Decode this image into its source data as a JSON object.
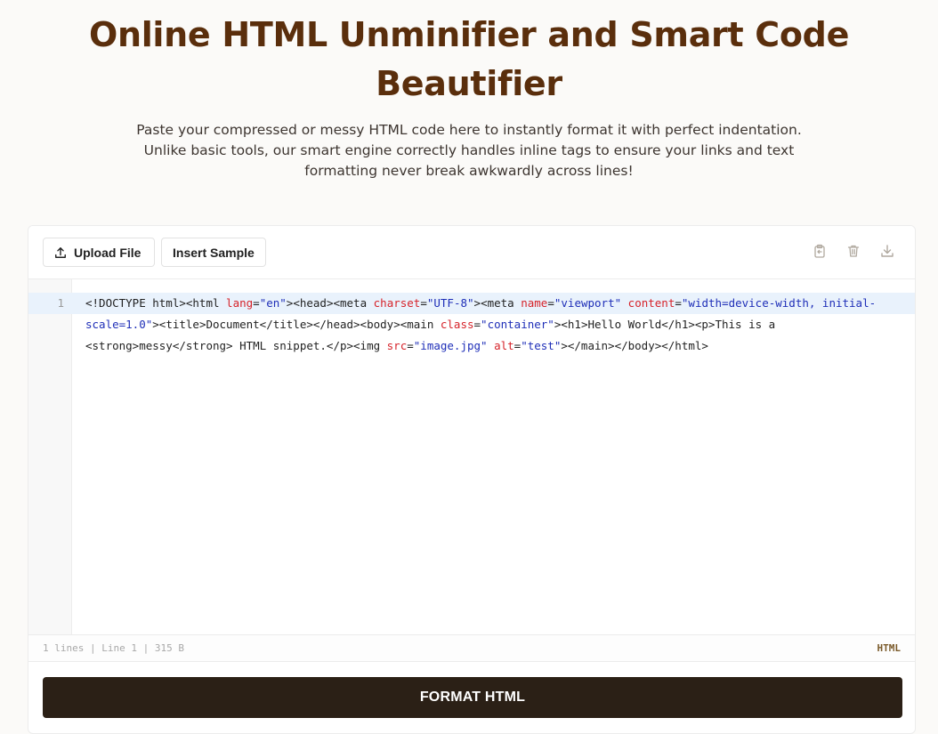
{
  "header": {
    "title_line1": "Online HTML Unminifier and Smart Code",
    "title_line2": "Beautifier",
    "subtitle_line1": "Paste your compressed or messy HTML code here to instantly format it with perfect indentation.",
    "subtitle_line2": "Unlike basic tools, our smart engine correctly handles inline tags to ensure your links and text",
    "subtitle_line3": "formatting never break awkwardly across lines!"
  },
  "toolbar": {
    "upload_label": "Upload File",
    "upload_icon": "upload-icon",
    "sample_label": "Insert Sample",
    "actions": [
      {
        "icon": "clipboard-icon",
        "name": "copy"
      },
      {
        "icon": "trash-icon",
        "name": "clear"
      },
      {
        "icon": "download-icon",
        "name": "download"
      }
    ]
  },
  "editor": {
    "line_number": "1",
    "code": "<!DOCTYPE html><html lang=\"en\"><head><meta charset=\"UTF-8\"><meta name=\"viewport\" content=\"width=device-width, initial-scale=1.0\"><title>Document</title></head><body><main class=\"container\"><h1>Hello World</h1><p>This is a <strong>messy</strong> HTML snippet.</p><img src=\"image.jpg\" alt=\"test\"></main></body></html>",
    "code_segments": [
      [
        {
          "t": "<!DOCTYPE html><html ",
          "k": "tag"
        },
        {
          "t": "lang",
          "k": "attr"
        },
        {
          "t": "=",
          "k": "tag"
        },
        {
          "t": "\"en\"",
          "k": "str"
        },
        {
          "t": "><head><meta ",
          "k": "tag"
        },
        {
          "t": "charset",
          "k": "attr"
        },
        {
          "t": "=",
          "k": "tag"
        },
        {
          "t": "\"UTF-8\"",
          "k": "str"
        },
        {
          "t": "><meta ",
          "k": "tag"
        },
        {
          "t": "name",
          "k": "attr"
        },
        {
          "t": "=",
          "k": "tag"
        },
        {
          "t": "\"viewport\"",
          "k": "str"
        },
        {
          "t": " ",
          "k": "tag"
        },
        {
          "t": "content",
          "k": "attr"
        },
        {
          "t": "=",
          "k": "tag"
        },
        {
          "t": "\"width=device-width, initial-",
          "k": "str"
        }
      ],
      [
        {
          "t": "scale=1.0\"",
          "k": "str"
        },
        {
          "t": "><title>Document</title></head><body><main ",
          "k": "tag"
        },
        {
          "t": "class",
          "k": "attr"
        },
        {
          "t": "=",
          "k": "tag"
        },
        {
          "t": "\"container\"",
          "k": "str"
        },
        {
          "t": "><h1>Hello World</h1><p>This is a",
          "k": "tag"
        }
      ],
      [
        {
          "t": "<strong>messy</strong> HTML snippet.</p><img ",
          "k": "tag"
        },
        {
          "t": "src",
          "k": "attr"
        },
        {
          "t": "=",
          "k": "tag"
        },
        {
          "t": "\"image.jpg\"",
          "k": "str"
        },
        {
          "t": " ",
          "k": "tag"
        },
        {
          "t": "alt",
          "k": "attr"
        },
        {
          "t": "=",
          "k": "tag"
        },
        {
          "t": "\"test\"",
          "k": "str"
        },
        {
          "t": "></main></body></html>",
          "k": "tag"
        }
      ]
    ]
  },
  "statusbar": {
    "info": "1 lines | Line 1 | 315 B",
    "language": "HTML"
  },
  "format_button": {
    "label": "FORMAT HTML"
  },
  "colors": {
    "title": "#5a2e0c",
    "attr": "#d6232a",
    "string": "#1f2fb8",
    "button_bg": "#2b2016",
    "highlight_line": "#e9f2fc"
  }
}
